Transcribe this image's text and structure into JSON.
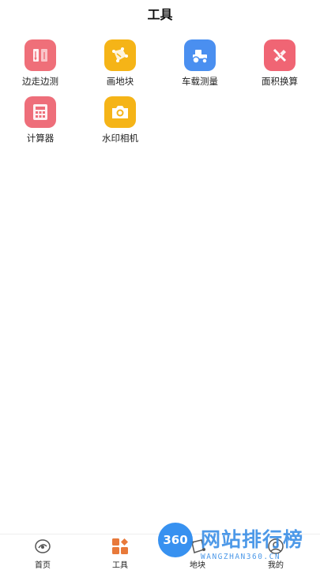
{
  "header": {
    "title": "工具"
  },
  "tools": [
    {
      "label": "边走边测",
      "icon": "walk-measure-icon",
      "color": "#ef6f79"
    },
    {
      "label": "画地块",
      "icon": "draw-plot-icon",
      "color": "#f5b417"
    },
    {
      "label": "车载测量",
      "icon": "tractor-icon",
      "color": "#4a8ff0"
    },
    {
      "label": "面积换算",
      "icon": "ruler-pencil-icon",
      "color": "#f06574"
    },
    {
      "label": "计算器",
      "icon": "calculator-icon",
      "color": "#ee6e7a"
    },
    {
      "label": "水印相机",
      "icon": "camera-icon",
      "color": "#f5b417"
    }
  ],
  "tabbar": {
    "items": [
      {
        "label": "首页",
        "icon": "home-icon",
        "active": false
      },
      {
        "label": "工具",
        "icon": "tools-grid-icon",
        "active": true
      },
      {
        "label": "地块",
        "icon": "plot-icon",
        "active": false
      },
      {
        "label": "我的",
        "icon": "profile-icon",
        "active": false
      }
    ]
  },
  "watermark": {
    "badge": "360",
    "text": "网站排行榜",
    "sub": "WANGZHAN360.CN"
  },
  "colors": {
    "active_tab": "#e8793a",
    "inactive_tab": "#555555"
  }
}
